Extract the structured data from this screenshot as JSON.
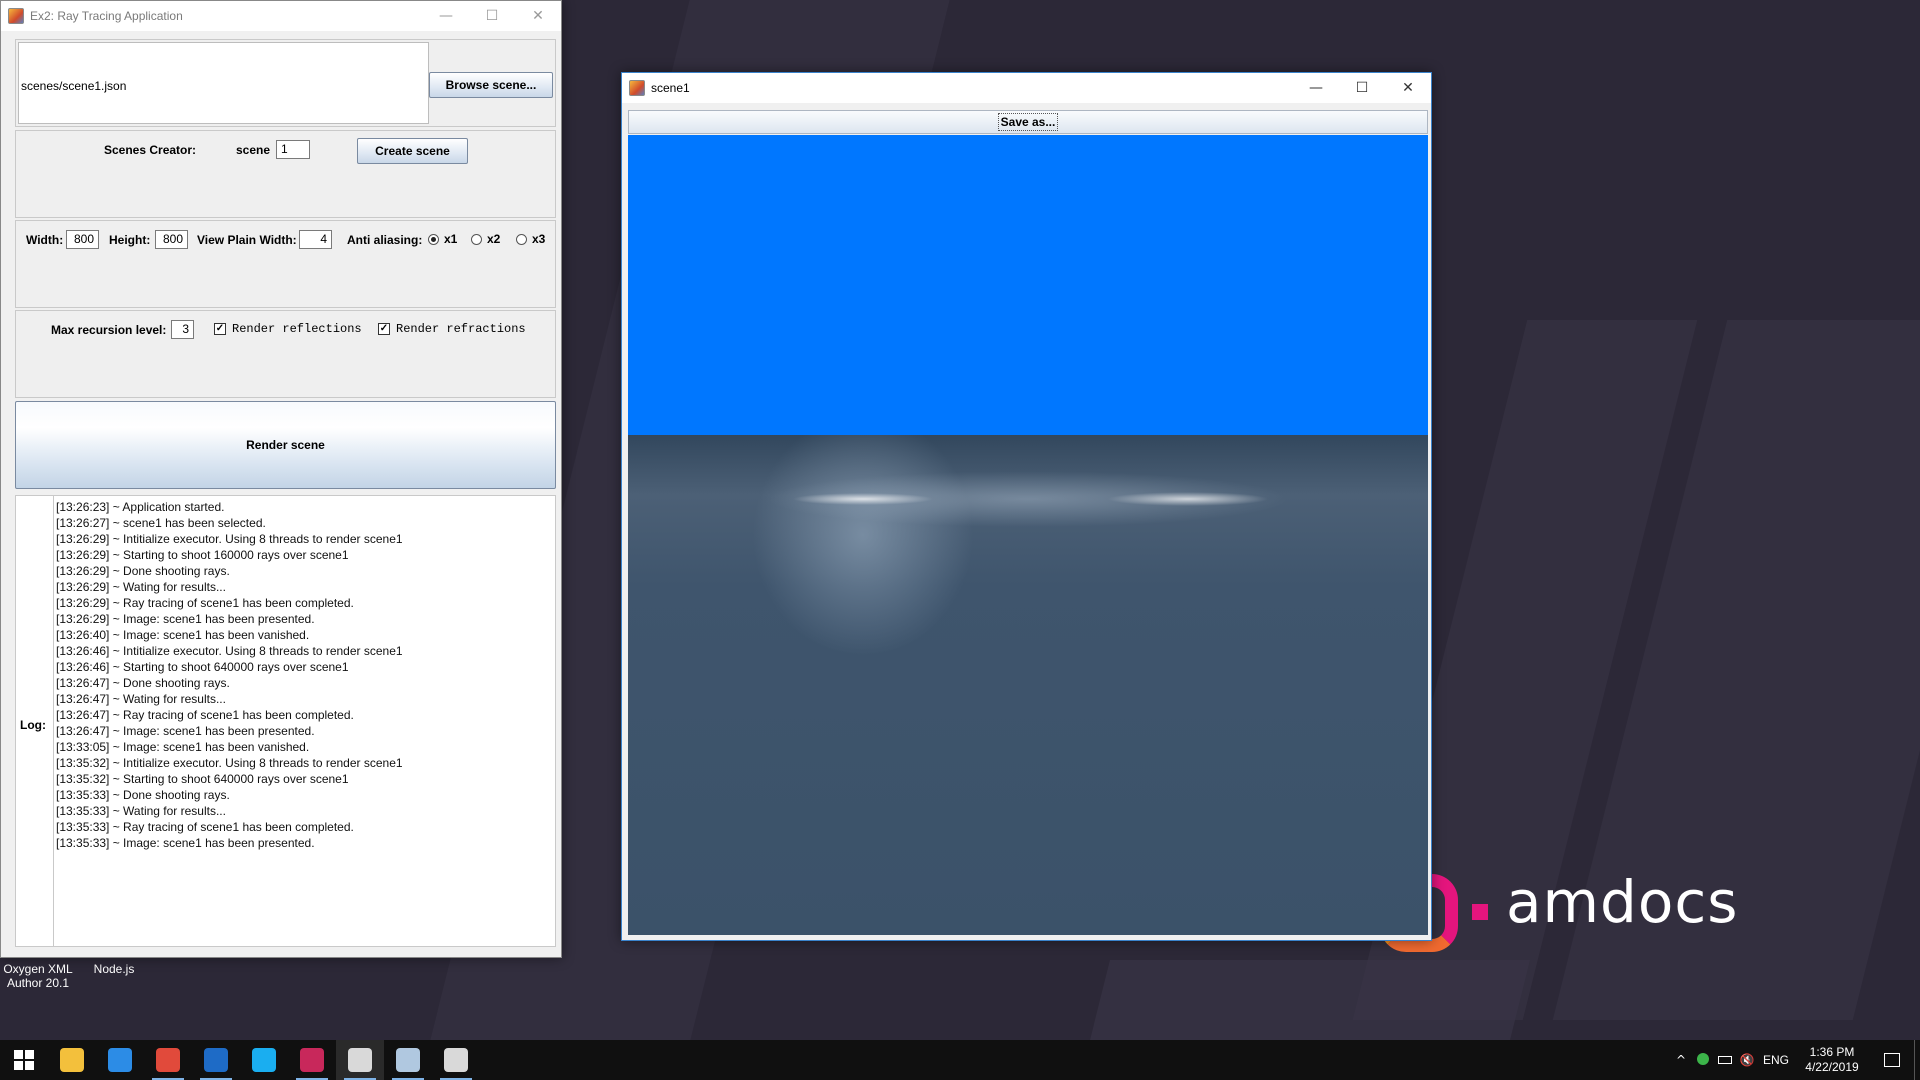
{
  "app": {
    "title": "Ex2: Ray Tracing Application",
    "scene_path": "scenes/scene1.json",
    "browse_label": "Browse scene...",
    "scenes_creator_label": "Scenes Creator:",
    "scene_label": "scene",
    "scene_value": "1",
    "create_scene_label": "Create scene",
    "width_label": "Width:",
    "width_value": "800",
    "height_label": "Height:",
    "height_value": "800",
    "view_plain_label": "View Plain Width:",
    "view_plain_value": "4",
    "aa_label": "Anti aliasing:",
    "aa_options": [
      "x1",
      "x2",
      "x3"
    ],
    "aa_selected": "x1",
    "max_rec_label": "Max recursion level:",
    "max_rec_value": "3",
    "render_reflections_label": "Render reflections",
    "render_reflections_checked": true,
    "render_refractions_label": "Render refractions",
    "render_refractions_checked": true,
    "render_label": "Render scene",
    "log_label": "Log:",
    "log": [
      "[13:26:23] ~ Application started.",
      "[13:26:27] ~ scene1 has been selected.",
      "[13:26:29] ~ Intitialize executor. Using 8 threads to render scene1",
      "[13:26:29] ~ Starting to shoot 160000 rays over scene1",
      "[13:26:29] ~ Done shooting rays.",
      "[13:26:29] ~ Wating for results...",
      "[13:26:29] ~ Ray tracing of scene1 has been completed.",
      "[13:26:29] ~ Image: scene1 has been presented.",
      "[13:26:40] ~ Image: scene1 has been vanished.",
      "[13:26:46] ~ Intitialize executor. Using 8 threads to render scene1",
      "[13:26:46] ~ Starting to shoot 640000 rays over scene1",
      "[13:26:47] ~ Done shooting rays.",
      "[13:26:47] ~ Wating for results...",
      "[13:26:47] ~ Ray tracing of scene1 has been completed.",
      "[13:26:47] ~ Image: scene1 has been presented.",
      "[13:33:05] ~ Image: scene1 has been vanished.",
      "[13:35:32] ~ Intitialize executor. Using 8 threads to render scene1",
      "[13:35:32] ~ Starting to shoot 640000 rays over scene1",
      "[13:35:33] ~ Done shooting rays.",
      "[13:35:33] ~ Wating for results...",
      "[13:35:33] ~ Ray tracing of scene1 has been completed.",
      "[13:35:33] ~ Image: scene1 has been presented."
    ]
  },
  "scene_window": {
    "title": "scene1",
    "save_as_label": "Save as...",
    "sky_color": "#0077ff",
    "ground_color": "#3b536b"
  },
  "window_controls": {
    "minimize": "—",
    "maximize": "☐",
    "close": "✕"
  },
  "desktop": {
    "brand": "amdocs",
    "brand_colors": [
      "#e4157d",
      "#f7901e"
    ],
    "icons": [
      {
        "label": "Oxygen XML Author 20.1",
        "icon": "oxygen-xml-icon",
        "color": "#d33a2c"
      },
      {
        "label": "Node.js",
        "icon": "nodejs-icon",
        "color": "#5fa04e"
      }
    ]
  },
  "taskbar": {
    "apps": [
      {
        "name": "file-explorer",
        "icon": "folder-icon",
        "color": "#f3c03c",
        "open": false
      },
      {
        "name": "internet-explorer",
        "icon": "ie-icon",
        "color": "#2c8ce6",
        "open": false
      },
      {
        "name": "chrome",
        "icon": "chrome-icon",
        "color": "#e14a3b",
        "open": true
      },
      {
        "name": "outlook",
        "icon": "outlook-icon",
        "color": "#1e6bc6",
        "open": true
      },
      {
        "name": "skype",
        "icon": "skype-icon",
        "color": "#1aaef0",
        "open": false
      },
      {
        "name": "intellij",
        "icon": "intellij-icon",
        "color": "#c8285b",
        "open": true
      },
      {
        "name": "java-app-1",
        "icon": "java-icon",
        "color": "#d9d9d9",
        "open": true,
        "active": true
      },
      {
        "name": "paint",
        "icon": "paint-icon",
        "color": "#b0c8e0",
        "open": true
      },
      {
        "name": "java-app-2",
        "icon": "java-icon",
        "color": "#d9d9d9",
        "open": true
      }
    ],
    "tray": {
      "up_arrow": "^",
      "language": "ENG",
      "time": "1:36 PM",
      "date": "4/22/2019"
    }
  }
}
